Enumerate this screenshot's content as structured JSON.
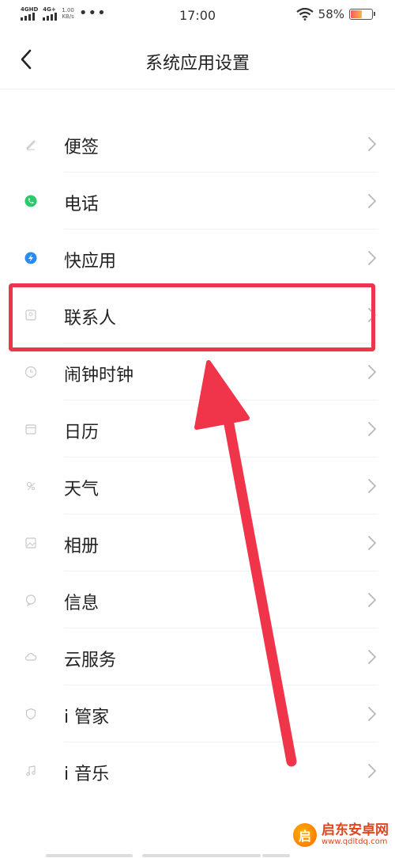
{
  "status_bar": {
    "sim1_label": "4GHD",
    "sim2_label": "4G+",
    "net_speed_value": "1.00",
    "net_speed_unit": "KB/s",
    "more": "•••",
    "time": "17:00",
    "battery_percent": "58%",
    "battery_level": 0.58
  },
  "header": {
    "title": "系统应用设置"
  },
  "items": [
    {
      "label": "便签"
    },
    {
      "label": "电话"
    },
    {
      "label": "快应用"
    },
    {
      "label": "联系人"
    },
    {
      "label": "闹钟时钟"
    },
    {
      "label": "日历"
    },
    {
      "label": "天气"
    },
    {
      "label": "相册"
    },
    {
      "label": "信息"
    },
    {
      "label": "云服务"
    },
    {
      "label": "i 管家"
    },
    {
      "label": "i 音乐"
    }
  ],
  "highlight_color": "#f0344a",
  "watermark": {
    "logo_char": "启",
    "name": "启东安卓网",
    "url": "www.qdltdq.com"
  }
}
